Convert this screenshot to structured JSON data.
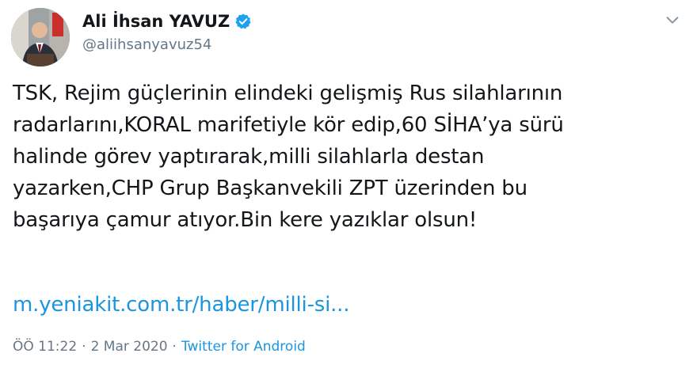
{
  "author": {
    "display_name": "Ali İhsan YAVUZ",
    "handle": "@aliihsanyavuz54",
    "verified": true
  },
  "icons": {
    "verified": "verified-badge-icon",
    "menu": "chevron-down-icon",
    "avatar": "profile-photo"
  },
  "tweet": {
    "text": "TSK, Rejim güçlerinin elindeki gelişmiş Rus silahlarının\nradarlarını,KORAL marifetiyle kör edip,60 SİHA’ya sürü\nhalinde görev yaptırarak,milli silahlarla destan\nyazarken,CHP Grup Başkanvekili ZPT üzerinden bu\nbaşarıya çamur atıyor.Bin kere yazıklar olsun!",
    "link_text": "m.yeniakit.com.tr/haber/milli-si...",
    "time": "ÖÖ 11:22",
    "separator": "·",
    "date": "2 Mar 2020",
    "source": "Twitter for Android"
  },
  "colors": {
    "text": "#14171a",
    "secondary": "#657786",
    "link": "#1b95e0",
    "verified_badge": "#1da1f2"
  }
}
